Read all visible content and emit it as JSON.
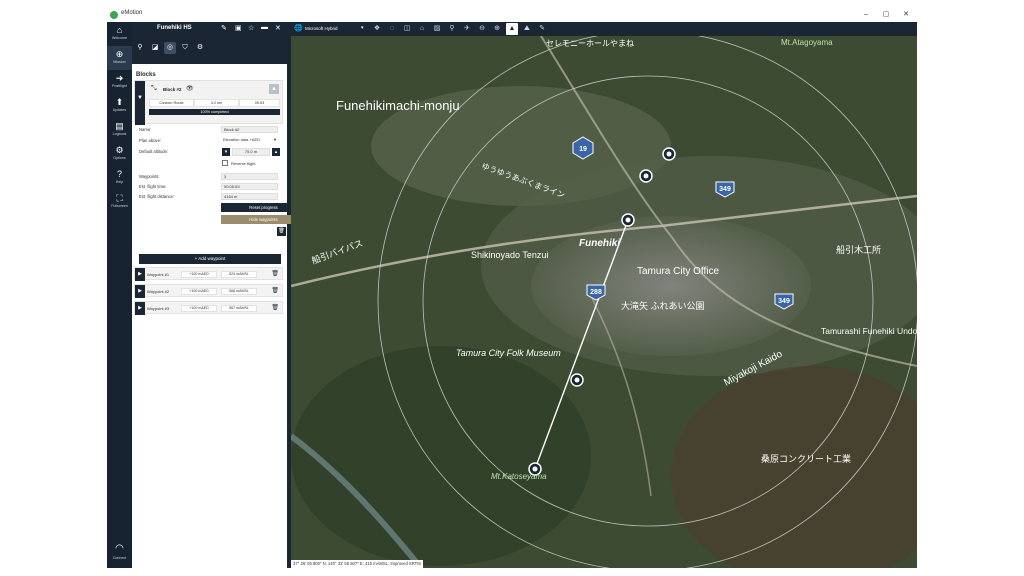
{
  "window": {
    "title": "eMotion",
    "min": "‒",
    "max": "▢",
    "close": "✕"
  },
  "rail": {
    "items": [
      {
        "label": "Welcome",
        "icon": "⌂"
      },
      {
        "label": "Mission",
        "icon": "⊕"
      },
      {
        "label": "Postflight",
        "icon": "➜"
      },
      {
        "label": "Updates",
        "icon": "⬆"
      },
      {
        "label": "Logbook",
        "icon": "▤"
      },
      {
        "label": "Options",
        "icon": "⚙"
      },
      {
        "label": "Help",
        "icon": "?"
      },
      {
        "label": "Fullscreen",
        "icon": "⛶"
      }
    ],
    "connect": {
      "label": "Connect",
      "icon": "◠"
    }
  },
  "panel": {
    "mission_name": "Funehiki HS",
    "section_title": "Blocks",
    "block": {
      "name": "Block #2",
      "route_type": "Custom Route",
      "distance": "4.2 km",
      "time": "05:53",
      "progress_text": "100% completed",
      "progress_fraction": 1.0
    },
    "form": {
      "name_label": "Name:",
      "name_value": "Block #2",
      "plan_above_label": "Plan above:",
      "plan_above_value": "Elevation data +AED",
      "default_altitude_label": "Default altitude:",
      "default_altitude_value": "75.0 m",
      "reverse_flight_label": "Reverse flight",
      "waypoints_label": "Waypoints:",
      "waypoints_value": "3",
      "est_time_label": "Est. flight time:",
      "est_time_value": "00:05:53",
      "est_distance_label": "Est. flight distance:",
      "est_distance_value": "4164 m",
      "reset_label": "Reset progress",
      "hide_label": "Hide waypoints"
    },
    "add_waypoint_label": "Add waypoint",
    "waypoints": [
      {
        "name": "Waypoint #1",
        "height": "+100 mAED",
        "amsl": "524 mAMSL"
      },
      {
        "name": "Waypoint #2",
        "height": "+100 mAED",
        "amsl": "566 mAMSL"
      },
      {
        "name": "Waypoint #3",
        "height": "+100 mAED",
        "amsl": "567 mAMSL"
      }
    ]
  },
  "map": {
    "layer": "Microsoft Hybrid",
    "coords": "37° 26' 05.900\" N, 140° 32' 55.507\" E; 415 mAMSL; Improved SRTM",
    "labels": [
      {
        "text": "Funehikimachi-monju"
      },
      {
        "text": "Funehiki"
      },
      {
        "text": "Tamura City Office"
      },
      {
        "text": "Shikinoyado Tenzui"
      },
      {
        "text": "Tamura City Folk Museum"
      },
      {
        "text": "Mt.Katoseyama"
      },
      {
        "text": "Miyakoji Kaido"
      },
      {
        "text": "Tamurashi Funehiki Undo-koen Park"
      },
      {
        "text": "大滝矢 ふれあい公園"
      },
      {
        "text": "船引バイパス"
      },
      {
        "text": "船引木工所"
      },
      {
        "text": "桑原コンクリート工業"
      },
      {
        "text": "Mt.Atagoyama"
      },
      {
        "text": "ゆうゆうあぶくまライン"
      },
      {
        "text": "セレモニーホールやまね"
      }
    ],
    "route_shields": [
      "19",
      "349",
      "288",
      "349"
    ]
  }
}
